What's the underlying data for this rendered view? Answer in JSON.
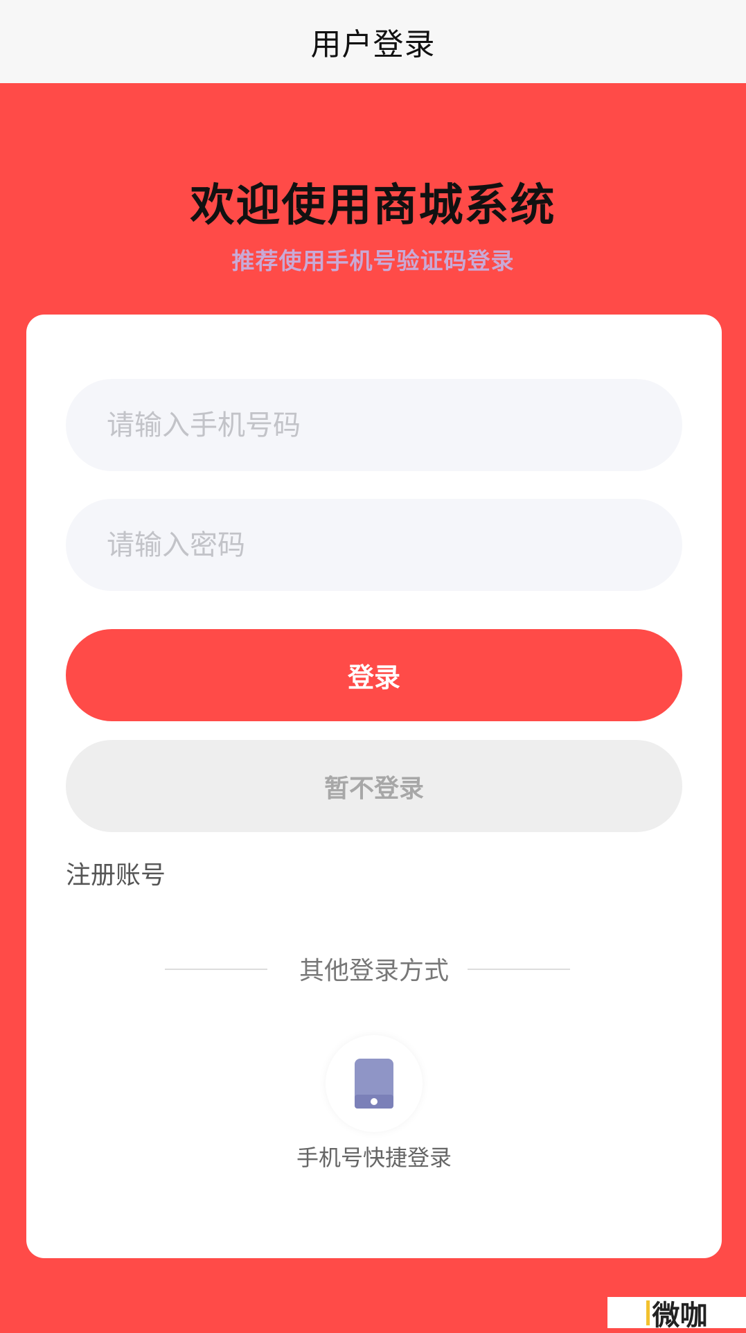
{
  "navbar": {
    "title": "用户登录"
  },
  "hero": {
    "title": "欢迎使用商城系统",
    "subtitle": "推荐使用手机号验证码登录"
  },
  "form": {
    "phone_placeholder": "请输入手机号码",
    "password_placeholder": "请输入密码",
    "login_label": "登录",
    "skip_label": "暂不登录",
    "register_label": "注册账号"
  },
  "other_login": {
    "divider_text": "其他登录方式",
    "quick_label": "手机号快捷登录",
    "icon": "mobile-phone-icon"
  },
  "watermark": {
    "text": "微咖"
  },
  "colors": {
    "primary": "#ff4b48",
    "subtitle": "#c9a9d6",
    "icon": "#8f95c6",
    "skip_bg": "#eeeeee"
  }
}
